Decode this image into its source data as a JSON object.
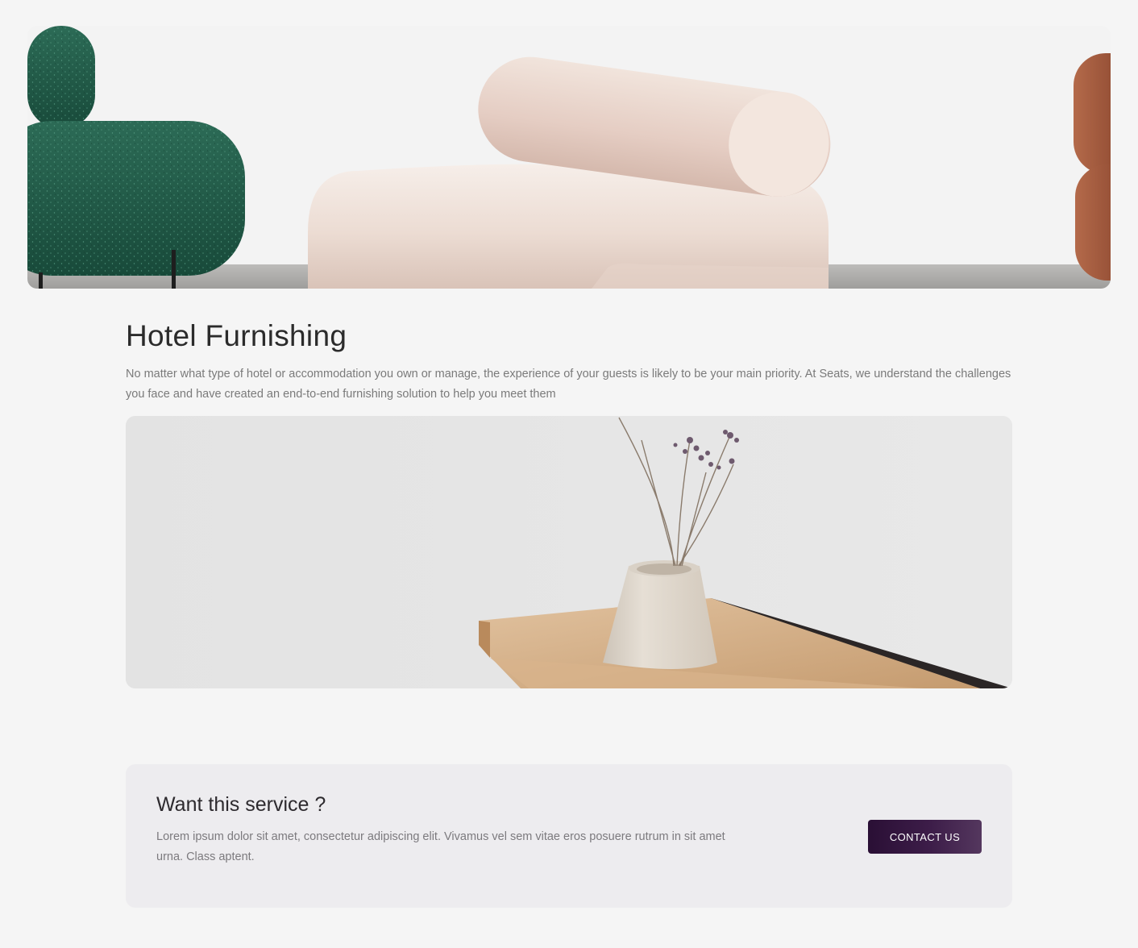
{
  "article": {
    "title": "Hotel Furnishing",
    "intro": "No matter what type of hotel or accommodation you own or manage, the experience of your guests is likely to be your main priority. At Seats, we understand the challenges you face and have created an end-to-end furnishing solution to help you meet them"
  },
  "cta": {
    "title": "Want this service ?",
    "text": "Lorem ipsum dolor sit amet, consectetur adipiscing elit. Vivamus vel sem vitae eros posuere rutrum in sit amet urna. Class aptent.",
    "button_label": "CONTACT US"
  },
  "colors": {
    "page_background": "#f5f5f5",
    "cta_background": "#edecef",
    "button_primary": "#2a0f35",
    "button_text": "#ffffff",
    "green_chair": "#1f5a48",
    "cream_chair": "#ecdcd3",
    "rust_chair": "#9b4f36"
  }
}
